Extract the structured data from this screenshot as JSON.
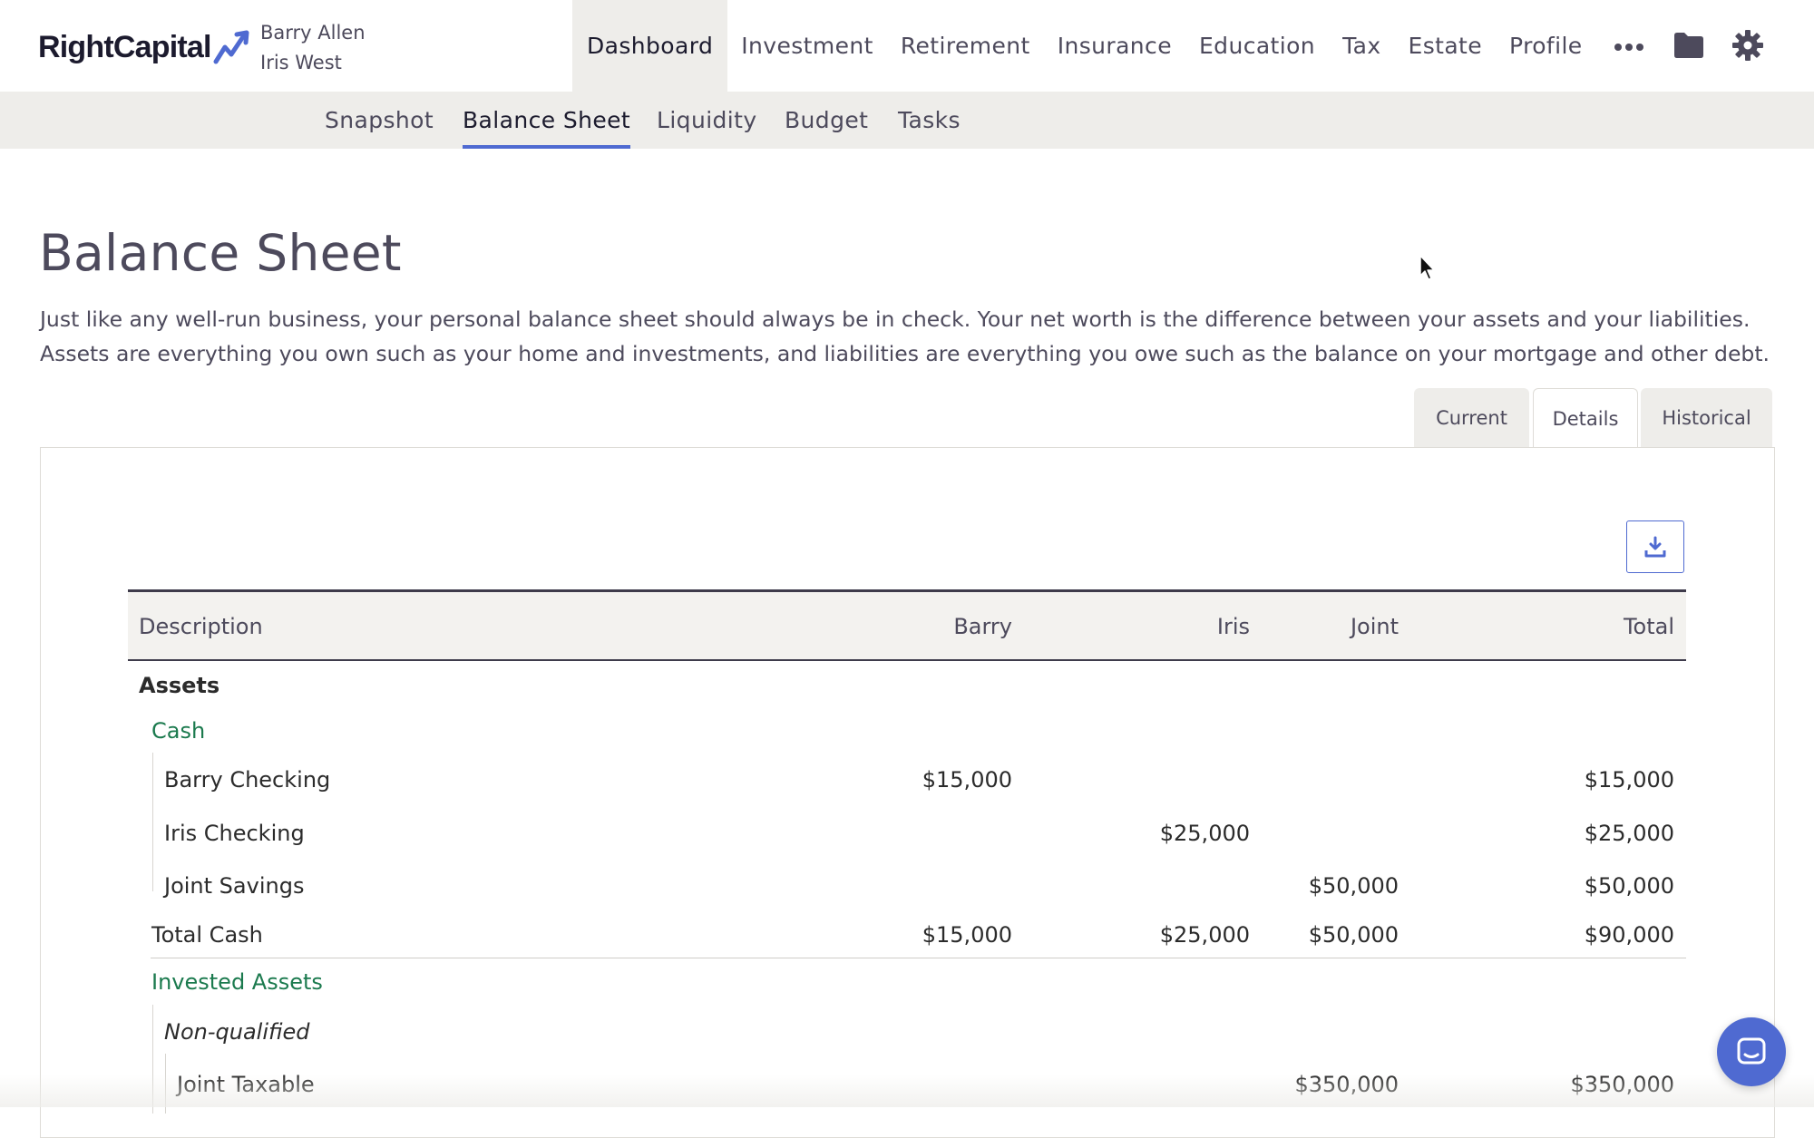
{
  "brand": {
    "name": "RightCapital"
  },
  "clients": [
    "Barry Allen",
    "Iris West"
  ],
  "main_nav": [
    {
      "label": "Dashboard",
      "active": true
    },
    {
      "label": "Investment"
    },
    {
      "label": "Retirement"
    },
    {
      "label": "Insurance"
    },
    {
      "label": "Education"
    },
    {
      "label": "Tax"
    },
    {
      "label": "Estate"
    },
    {
      "label": "Profile"
    }
  ],
  "nav_icons": [
    "more-icon",
    "folder-icon",
    "gear-icon"
  ],
  "sub_nav": [
    {
      "label": "Snapshot"
    },
    {
      "label": "Balance Sheet",
      "active": true
    },
    {
      "label": "Liquidity"
    },
    {
      "label": "Budget"
    },
    {
      "label": "Tasks"
    }
  ],
  "page": {
    "title": "Balance Sheet",
    "description": "Just like any well-run business, your personal balance sheet should always be in check. Your net worth is the difference between your assets and your liabilities. Assets are everything you own such as your home and investments, and liabilities are everything you owe such as the balance on your mortgage and other debt."
  },
  "view_tabs": [
    {
      "label": "Current"
    },
    {
      "label": "Details",
      "active": true
    },
    {
      "label": "Historical"
    }
  ],
  "table": {
    "columns": [
      "Description",
      "Barry",
      "Iris",
      "Joint",
      "Total"
    ],
    "assets_label": "Assets",
    "cash": {
      "label": "Cash",
      "rows": [
        {
          "name": "Barry Checking",
          "barry": "$15,000",
          "iris": "",
          "joint": "",
          "total": "$15,000"
        },
        {
          "name": "Iris Checking",
          "barry": "",
          "iris": "$25,000",
          "joint": "",
          "total": "$25,000"
        },
        {
          "name": "Joint Savings",
          "barry": "",
          "iris": "",
          "joint": "$50,000",
          "total": "$50,000"
        }
      ],
      "total": {
        "name": "Total Cash",
        "barry": "$15,000",
        "iris": "$25,000",
        "joint": "$50,000",
        "total": "$90,000"
      }
    },
    "invested": {
      "label": "Invested Assets",
      "subgroup": "Non-qualified",
      "rows": [
        {
          "name": "Joint Taxable",
          "barry": "",
          "iris": "",
          "joint": "$350,000",
          "total": "$350,000"
        }
      ]
    }
  },
  "colors": {
    "accent": "#4f6ad1",
    "group_label": "#1b7a4e",
    "nav_bg": "#eeedea",
    "text": "#4d4a5c"
  }
}
